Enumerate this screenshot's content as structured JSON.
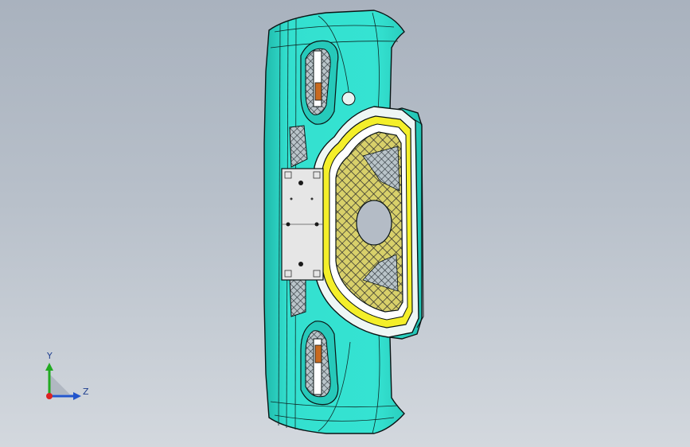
{
  "viewport": {
    "background_top": "#a9b2be",
    "background_bottom": "#d3d8de"
  },
  "model": {
    "name": "bumper-assembly",
    "colors": {
      "body": "#33e0cf",
      "body_shade": "#1fb8aa",
      "outline": "#0a1414",
      "grille_frame": "#f4ef2a",
      "mesh": "#cfc86a",
      "dark_mesh": "#5d6b72",
      "plate": "#e6e6e6"
    }
  },
  "triad": {
    "y_label": "Y",
    "z_label": "Z",
    "y_color": "#22aa22",
    "z_color": "#2255cc",
    "x_color": "#dd2222",
    "icon": "coordinate-triad-icon"
  }
}
